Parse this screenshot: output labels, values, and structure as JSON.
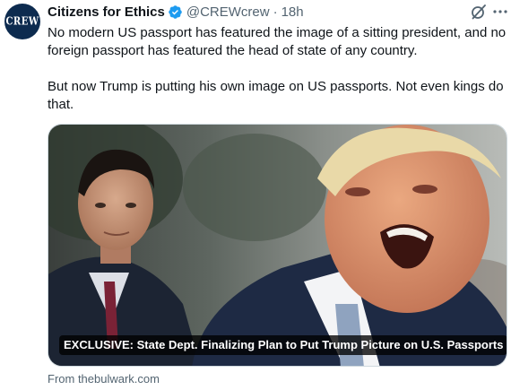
{
  "tweet": {
    "avatar_text": "CREW",
    "display_name": "Citizens for Ethics",
    "handle": "@CREWcrew",
    "separator": "·",
    "time": "18h",
    "paragraphs": [
      "No modern US passport has featured the image of a sitting president, and no foreign passport has featured the head of state of any country.",
      "But now Trump is putting his own image on US passports. Not even kings do that."
    ]
  },
  "card": {
    "caption": "EXCLUSIVE: State Dept. Finalizing Plan to Put Trump Picture on U.S. Passports",
    "source": "From thebulwark.com"
  },
  "icons": {
    "verified": "verified-badge-icon",
    "grok": "grok-icon",
    "more": "more-icon"
  },
  "colors": {
    "accent": "#1d9bf0",
    "text_primary": "#0f1419",
    "text_secondary": "#536471",
    "avatar_bg": "#0d2b4f"
  }
}
